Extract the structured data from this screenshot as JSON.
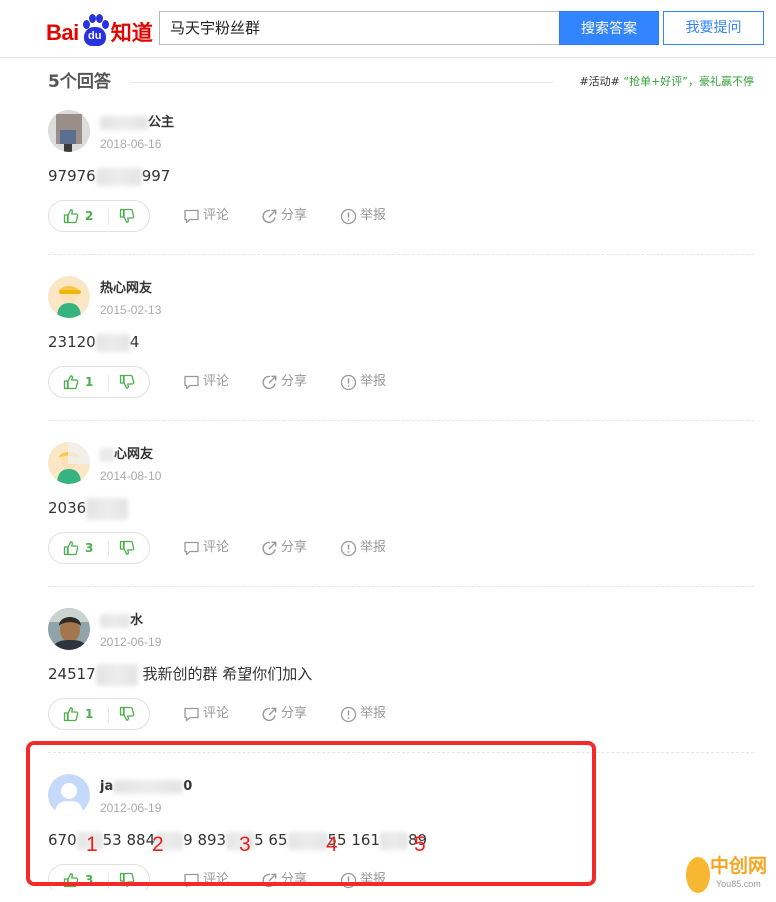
{
  "header": {
    "logo_bai": "Bai",
    "logo_du": "du",
    "logo_zhidao": "知道",
    "search_value": "马天宇粉丝群",
    "search_button": "搜索答案",
    "ask_button": "我要提问"
  },
  "answers_header": {
    "count_label": "5个回答",
    "activity_tag": "#活动#",
    "activity_promo": "“抢单+好评”，豪礼赢不停"
  },
  "action_labels": {
    "comment": "评论",
    "share": "分享",
    "report": "举报"
  },
  "answers": [
    {
      "name_suffix": "公主",
      "date": "2018-06-16",
      "content_start": "97976",
      "content_end": "997",
      "likes": "2"
    },
    {
      "name": "热心网友",
      "date": "2015-02-13",
      "content_start": "23120",
      "content_end": "4",
      "likes": "1"
    },
    {
      "name_suffix": "心网友",
      "date": "2014-08-10",
      "content_start": "2036",
      "likes": "3"
    },
    {
      "name_suffix": "水",
      "date": "2012-06-19",
      "content_start": "24517",
      "content_end": " 我新创的群 希望你们加入",
      "likes": "1"
    },
    {
      "name_start": "ja",
      "name_end": "0",
      "date": "2012-06-19",
      "content_parts": [
        "670",
        "53 884",
        "9 893",
        "5 65",
        "55 161",
        "89"
      ],
      "likes": "3"
    }
  ],
  "annotations": [
    "1",
    "2",
    "3",
    "4",
    "5"
  ],
  "watermark": {
    "text": "中创网",
    "url": "You85.com"
  },
  "colors": {
    "brand_red": "#e10602",
    "brand_blue": "#2932e1",
    "accent": "#3385ff",
    "like_green": "#4cae4c",
    "highlight": "#f22a2a"
  }
}
